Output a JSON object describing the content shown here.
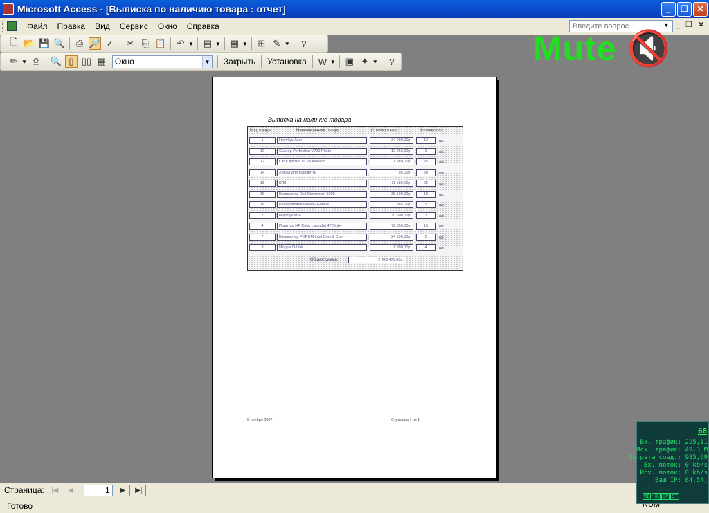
{
  "window": {
    "title": "Microsoft Access - [Выписка по наличию товара : отчет]"
  },
  "menu": {
    "items": [
      "Файл",
      "Правка",
      "Вид",
      "Сервис",
      "Окно",
      "Справка"
    ],
    "help_placeholder": "Введите вопрос"
  },
  "toolbar2": {
    "zoom_value": "Окно",
    "close_label": "Закрыть",
    "setup_label": "Установка"
  },
  "overlay": {
    "mute_text": "Mute"
  },
  "report": {
    "title": "Выписка на наличие товара",
    "headers": [
      "Код товара",
      "Наименование товара",
      "Стоимость/шт",
      "Количество"
    ],
    "rows": [
      {
        "code": "1",
        "name": "Ноутбук Acer",
        "price": "34 000,00р.",
        "qty": "12",
        "unit": "шт."
      },
      {
        "code": "10",
        "name": "Сканер Perfection V700 Photo",
        "price": "12 960,00р.",
        "qty": "1",
        "unit": "шт."
      },
      {
        "code": "12",
        "name": "Стол д/комп DL-004/beech",
        "price": "1 980,00р.",
        "qty": "25",
        "unit": "шт."
      },
      {
        "code": "14",
        "name": "Линзы для подсветки",
        "price": "95,00р.",
        "qty": "50",
        "unit": "шт."
      },
      {
        "code": "15",
        "name": "КПК",
        "price": "11 580,00р.",
        "qty": "25",
        "unit": "шт."
      },
      {
        "code": "16",
        "name": "Компьютер Dell Dimension 9300",
        "price": "35 100,00р.",
        "qty": "10",
        "unit": "шт."
      },
      {
        "code": "18",
        "name": "Беспроводная мышь Genius",
        "price": "385,00р.",
        "qty": "3",
        "unit": "шт."
      },
      {
        "code": "2",
        "name": "Ноутбук MSI",
        "price": "30 600,00р.",
        "qty": "3",
        "unit": "шт."
      },
      {
        "code": "4",
        "name": "Принтер HP Color LaserJet 4700ph+",
        "price": "72 850,00р.",
        "qty": "15",
        "unit": "шт."
      },
      {
        "code": "7",
        "name": "Компьютер FORUM Intel Core 2 Duo",
        "price": "24 100,00р.",
        "qty": "5",
        "unit": "шт."
      },
      {
        "code": "9",
        "name": "Модем D-Link",
        "price": "1 990,00р.",
        "qty": "4",
        "unit": "шт."
      }
    ],
    "total_label": "Общая сумма",
    "total_value": "2 429 475,00р.",
    "footer_date": "8 ноября 2007",
    "footer_page": "Страница 1 из 1"
  },
  "navigation": {
    "label": "Страница:",
    "page": "1"
  },
  "status": {
    "text": "Готово",
    "num": "NUM"
  },
  "traffic_widget": {
    "header": "68",
    "lines": [
      "Вх. трафик: 225,11",
      "Исх. трафик: 49,3 M",
      "Затраты соед.: 985,69",
      "Вх. поток: 0 kb/s",
      "Исх. поток: 0 kb/s",
      "Ваш IP: 84,54,"
    ],
    "buttons": [
      "RE",
      "HG",
      "OP",
      "ST"
    ]
  }
}
